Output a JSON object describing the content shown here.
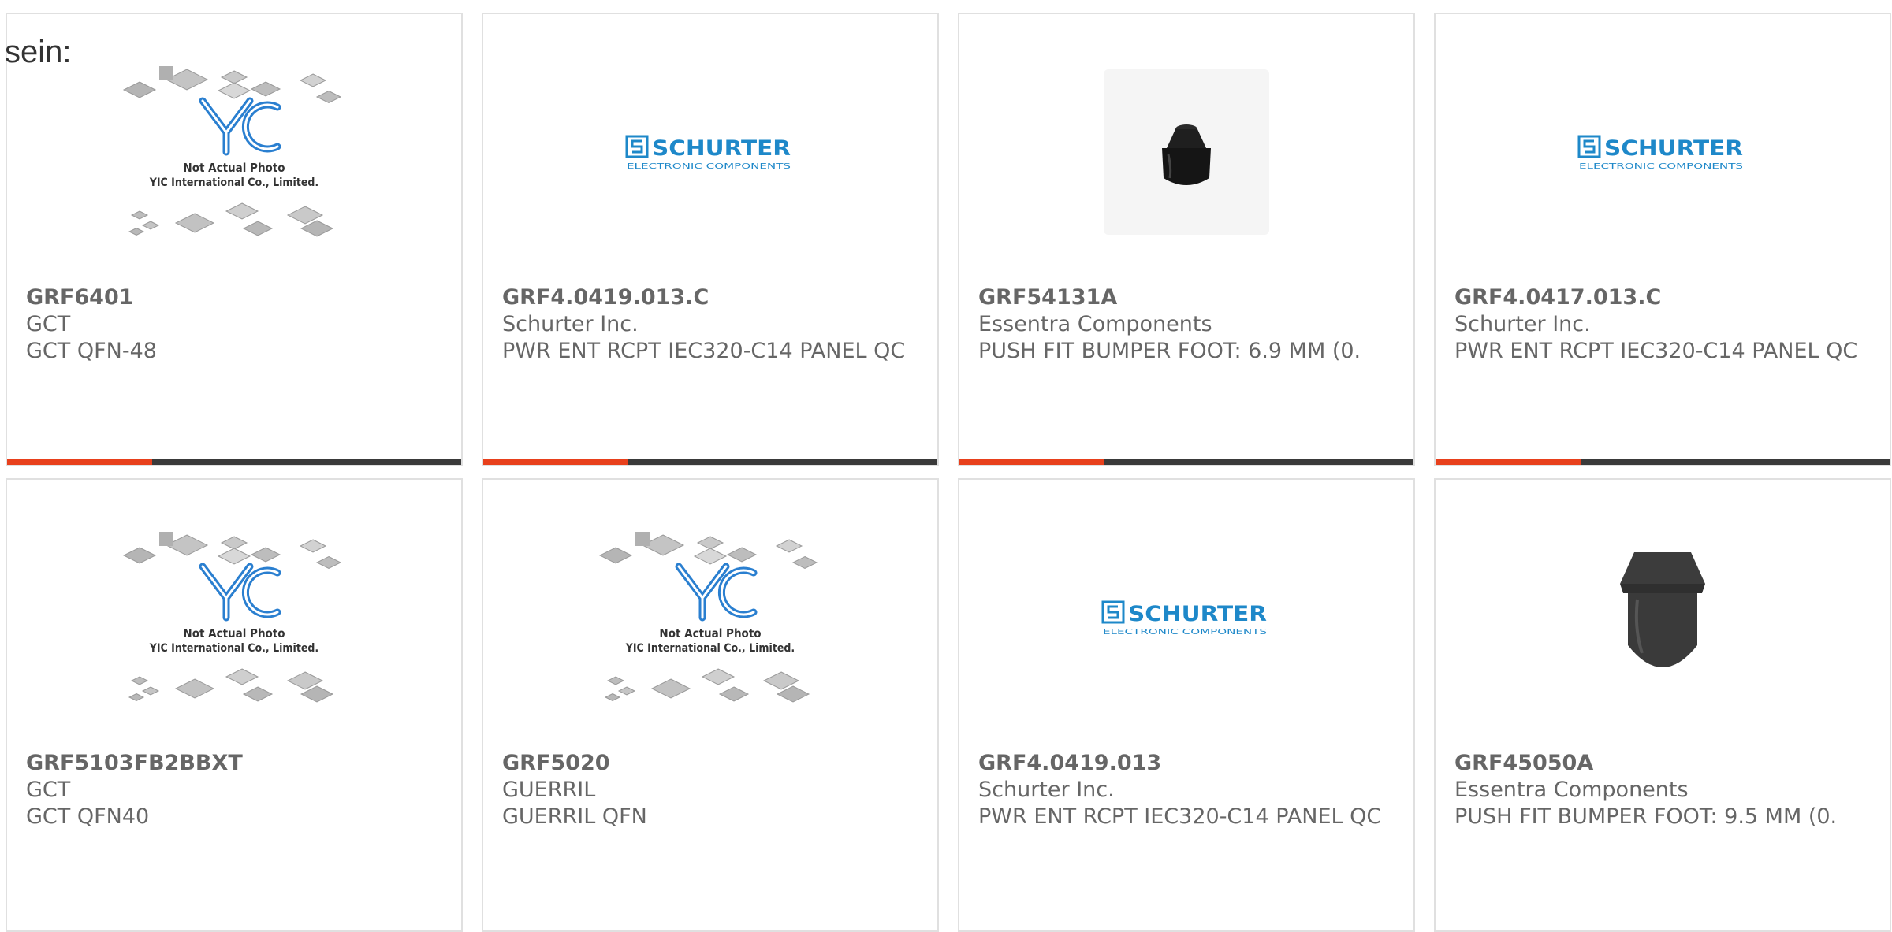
{
  "lead_text": "sein:",
  "colors": {
    "accent": "#e8401c",
    "bar": "#3a3a3a",
    "schurter_blue": "#1e88c9"
  },
  "products": [
    {
      "part": "GRF6401",
      "manufacturer": "GCT",
      "description": "GCT QFN-48",
      "image": "yic-placeholder",
      "image_text": {
        "note": "Not Actual Photo",
        "company": "YIC International Co., Limited."
      }
    },
    {
      "part": "GRF4.0419.013.C",
      "manufacturer": "Schurter Inc.",
      "description": "PWR ENT RCPT IEC320-C14 PANEL QC",
      "image": "schurter-logo",
      "image_text": {
        "brand": "SCHURTER",
        "tagline": "ELECTRONIC COMPONENTS"
      }
    },
    {
      "part": "GRF54131A",
      "manufacturer": "Essentra Components",
      "description": "PUSH FIT BUMPER FOOT: 6.9 MM (0.",
      "image": "bumper-foot-small"
    },
    {
      "part": "GRF4.0417.013.C",
      "manufacturer": "Schurter Inc.",
      "description": "PWR ENT RCPT IEC320-C14 PANEL QC",
      "image": "schurter-logo",
      "image_text": {
        "brand": "SCHURTER",
        "tagline": "ELECTRONIC COMPONENTS"
      }
    },
    {
      "part": "GRF5103FB2BBXT",
      "manufacturer": "GCT",
      "description": "GCT QFN40",
      "image": "yic-placeholder",
      "image_text": {
        "note": "Not Actual Photo",
        "company": "YIC International Co., Limited."
      }
    },
    {
      "part": "GRF5020",
      "manufacturer": "GUERRIL",
      "description": "GUERRIL QFN",
      "image": "yic-placeholder",
      "image_text": {
        "note": "Not Actual Photo",
        "company": "YIC International Co., Limited."
      }
    },
    {
      "part": "GRF4.0419.013",
      "manufacturer": "Schurter Inc.",
      "description": "PWR ENT RCPT IEC320-C14 PANEL QC",
      "image": "schurter-logo",
      "image_text": {
        "brand": "SCHURTER",
        "tagline": "ELECTRONIC COMPONENTS"
      }
    },
    {
      "part": "GRF45050A",
      "manufacturer": "Essentra Components",
      "description": "PUSH FIT BUMPER FOOT: 9.5 MM (0.",
      "image": "bumper-foot-large"
    }
  ]
}
